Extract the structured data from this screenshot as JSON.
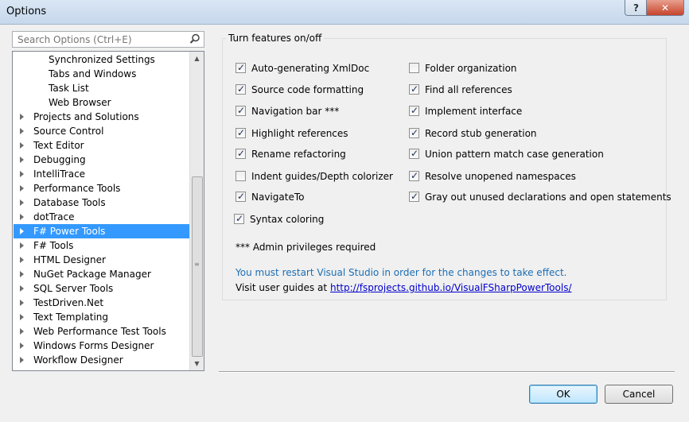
{
  "window": {
    "title": "Options",
    "help_label": "?",
    "close_label": "✕"
  },
  "search": {
    "placeholder": "Search Options (Ctrl+E)"
  },
  "tree": {
    "items": [
      {
        "label": "Synchronized Settings",
        "level": 1,
        "expandable": false,
        "selected": false
      },
      {
        "label": "Tabs and Windows",
        "level": 1,
        "expandable": false,
        "selected": false
      },
      {
        "label": "Task List",
        "level": 1,
        "expandable": false,
        "selected": false
      },
      {
        "label": "Web Browser",
        "level": 1,
        "expandable": false,
        "selected": false
      },
      {
        "label": "Projects and Solutions",
        "level": 0,
        "expandable": true,
        "selected": false
      },
      {
        "label": "Source Control",
        "level": 0,
        "expandable": true,
        "selected": false
      },
      {
        "label": "Text Editor",
        "level": 0,
        "expandable": true,
        "selected": false
      },
      {
        "label": "Debugging",
        "level": 0,
        "expandable": true,
        "selected": false
      },
      {
        "label": "IntelliTrace",
        "level": 0,
        "expandable": true,
        "selected": false
      },
      {
        "label": "Performance Tools",
        "level": 0,
        "expandable": true,
        "selected": false
      },
      {
        "label": "Database Tools",
        "level": 0,
        "expandable": true,
        "selected": false
      },
      {
        "label": "dotTrace",
        "level": 0,
        "expandable": true,
        "selected": false
      },
      {
        "label": "F# Power Tools",
        "level": 0,
        "expandable": true,
        "selected": true
      },
      {
        "label": "F# Tools",
        "level": 0,
        "expandable": true,
        "selected": false
      },
      {
        "label": "HTML Designer",
        "level": 0,
        "expandable": true,
        "selected": false
      },
      {
        "label": "NuGet Package Manager",
        "level": 0,
        "expandable": true,
        "selected": false
      },
      {
        "label": "SQL Server Tools",
        "level": 0,
        "expandable": true,
        "selected": false
      },
      {
        "label": "TestDriven.Net",
        "level": 0,
        "expandable": true,
        "selected": false
      },
      {
        "label": "Text Templating",
        "level": 0,
        "expandable": true,
        "selected": false
      },
      {
        "label": "Web Performance Test Tools",
        "level": 0,
        "expandable": true,
        "selected": false
      },
      {
        "label": "Windows Forms Designer",
        "level": 0,
        "expandable": true,
        "selected": false
      },
      {
        "label": "Workflow Designer",
        "level": 0,
        "expandable": true,
        "selected": false
      }
    ]
  },
  "features": {
    "group_title": "Turn features on/off",
    "left": [
      {
        "label": "Auto-generating XmlDoc",
        "checked": true
      },
      {
        "label": "Source code formatting",
        "checked": true
      },
      {
        "label": "Navigation bar ***",
        "checked": true
      },
      {
        "label": "Highlight references",
        "checked": true
      },
      {
        "label": "Rename refactoring",
        "checked": true
      },
      {
        "label": "Indent guides/Depth colorizer",
        "checked": false
      },
      {
        "label": "NavigateTo",
        "checked": true
      },
      {
        "label": "Syntax coloring",
        "checked": true
      }
    ],
    "right": [
      {
        "label": "Folder organization",
        "checked": false
      },
      {
        "label": "Find all references",
        "checked": true
      },
      {
        "label": "Implement interface",
        "checked": true
      },
      {
        "label": "Record stub generation",
        "checked": true
      },
      {
        "label": "Union pattern match case generation",
        "checked": true
      },
      {
        "label": "Resolve unopened namespaces",
        "checked": true
      },
      {
        "label": "Gray out unused declarations and open statements",
        "checked": true
      }
    ],
    "admin_note": "*** Admin privileges required",
    "restart_warning": "You must restart Visual Studio in order for the changes to take effect.",
    "guides_label": "Visit user guides at",
    "guides_link": "http://fsprojects.github.io/VisualFSharpPowerTools/"
  },
  "buttons": {
    "ok": "OK",
    "cancel": "Cancel"
  },
  "colors": {
    "selection": "#3399ff",
    "warning_text": "#1c6eb4",
    "link": "#0000cc"
  }
}
